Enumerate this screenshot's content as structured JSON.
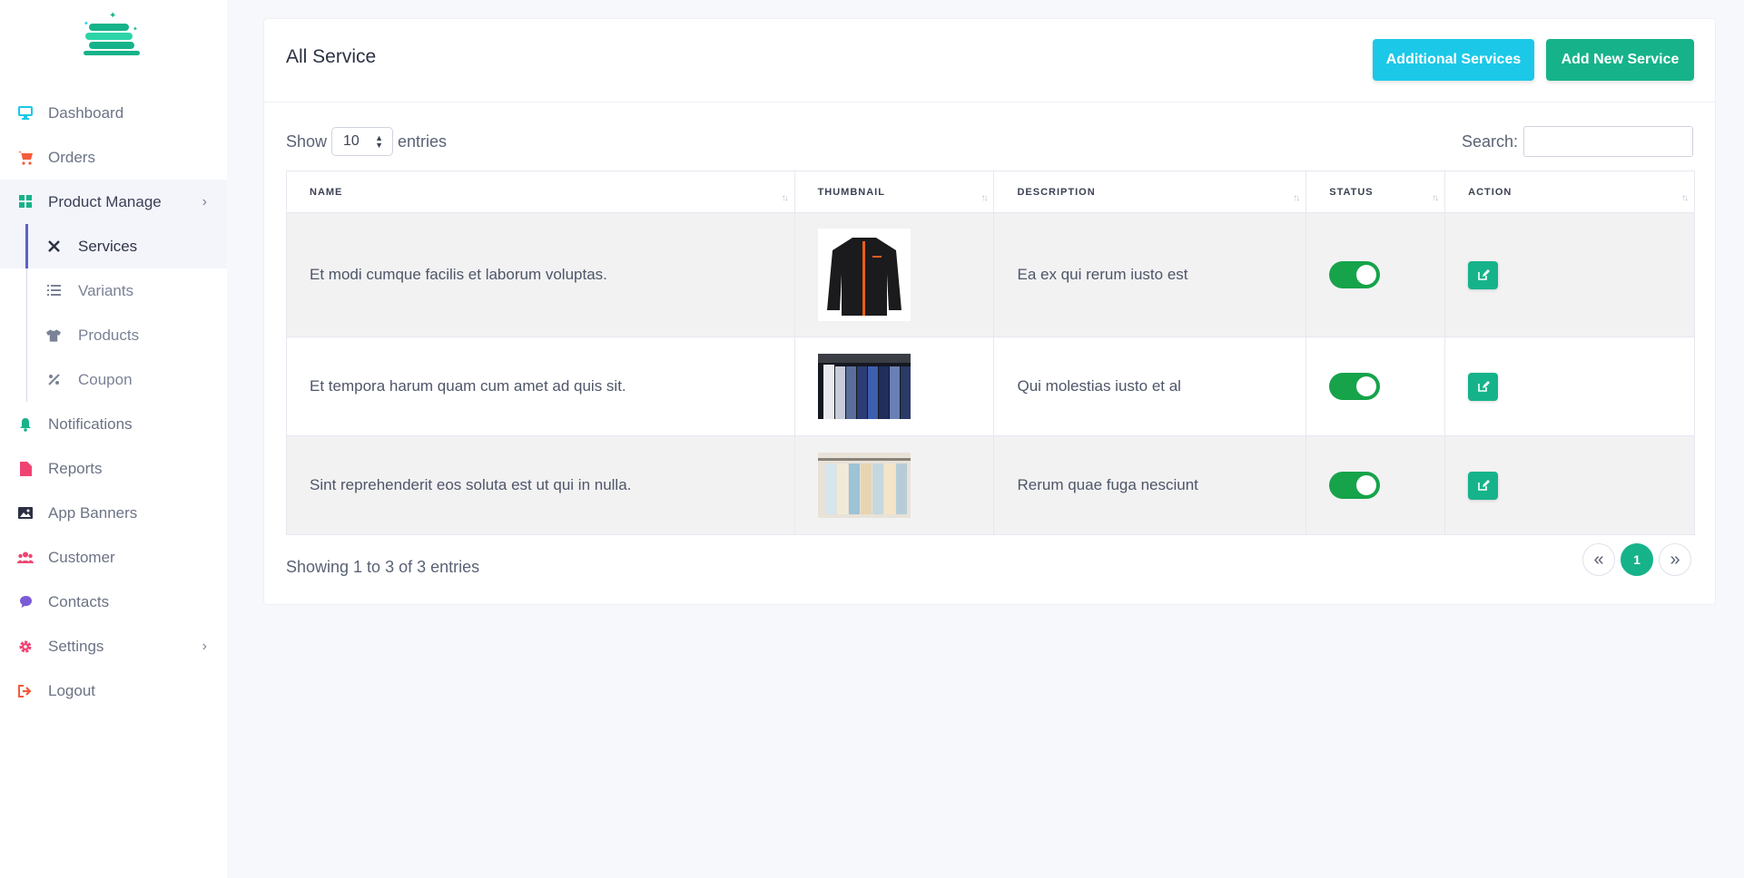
{
  "colors": {
    "accent": "#16b38a",
    "cyan": "#1cc8e8",
    "toggle_on": "#16a34a",
    "sidebar_active_bar": "#5b61c9"
  },
  "sidebar": {
    "items": [
      {
        "label": "Dashboard",
        "icon": "monitor-icon",
        "color": "#1cc8e8"
      },
      {
        "label": "Orders",
        "icon": "cart-icon",
        "color": "#f45b3c"
      },
      {
        "label": "Product Manage",
        "icon": "grid-icon",
        "color": "#16b38a"
      },
      {
        "label": "Notifications",
        "icon": "bell-icon",
        "color": "#16b38a"
      },
      {
        "label": "Reports",
        "icon": "file-icon",
        "color": "#ef4472"
      },
      {
        "label": "App Banners",
        "icon": "image-icon",
        "color": "#2b3142"
      },
      {
        "label": "Customer",
        "icon": "users-icon",
        "color": "#ef4472"
      },
      {
        "label": "Contacts",
        "icon": "chat-icon",
        "color": "#7c5cd6"
      },
      {
        "label": "Settings",
        "icon": "gear-icon",
        "color": "#ef4472"
      },
      {
        "label": "Logout",
        "icon": "logout-icon",
        "color": "#f45b3c"
      }
    ],
    "sub_items": [
      {
        "label": "Services",
        "icon": "tools-icon"
      },
      {
        "label": "Variants",
        "icon": "list-icon"
      },
      {
        "label": "Products",
        "icon": "tshirt-icon"
      },
      {
        "label": "Coupon",
        "icon": "percent-icon"
      }
    ]
  },
  "header": {
    "title": "All Service",
    "additional_label": "Additional Services",
    "add_new_label": "Add New Service"
  },
  "controls": {
    "show_label": "Show",
    "entries_value": "10",
    "entries_label": "entries",
    "search_label": "Search:"
  },
  "table": {
    "columns": [
      "NAME",
      "THUMBNAIL",
      "DESCRIPTION",
      "STATUS",
      "ACTION"
    ],
    "rows": [
      {
        "name": "Et modi cumque facilis et laborum voluptas.",
        "description": "Ea ex qui rerum iusto est",
        "status": true
      },
      {
        "name": "Et tempora harum quam cum amet ad quis sit.",
        "description": "Qui molestias iusto et al",
        "status": true
      },
      {
        "name": "Sint reprehenderit eos soluta est ut qui in nulla.",
        "description": "Rerum quae fuga nesciunt",
        "status": true
      }
    ]
  },
  "footer": {
    "info": "Showing 1 to 3 of 3 entries",
    "prev": "«",
    "page": "1",
    "next": "»"
  }
}
